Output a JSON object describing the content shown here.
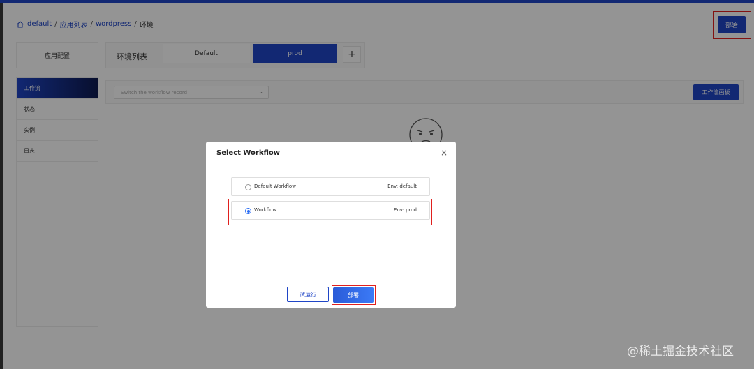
{
  "breadcrumb": {
    "items": [
      "default",
      "应用列表",
      "wordpress"
    ],
    "current": "环境",
    "separator": "/"
  },
  "header": {
    "deploy_label": "部署"
  },
  "app_config_label": "应用配置",
  "env": {
    "title": "环境列表",
    "tabs": [
      "Default",
      "prod"
    ],
    "active_tab": "prod",
    "add_label": "+"
  },
  "sidebar": {
    "items": [
      {
        "label": "工作流",
        "active": true
      },
      {
        "label": "状态",
        "active": false
      },
      {
        "label": "实例",
        "active": false
      },
      {
        "label": "日志",
        "active": false
      }
    ]
  },
  "workflow_bar": {
    "select_placeholder": "Switch the workflow record",
    "board_label": "工作流画板"
  },
  "modal": {
    "title": "Select Workflow",
    "close_label": "×",
    "options": [
      {
        "name": "Default Workflow",
        "env": "Env: default",
        "selected": false
      },
      {
        "name": "Workflow",
        "env": "Env: prod",
        "selected": true
      }
    ],
    "trial_label": "试运行",
    "deploy_label": "部署"
  },
  "watermark": "@稀土掘金技术社区",
  "colors": {
    "primary": "#1f45c6",
    "highlight": "#e0201e",
    "radio": "#2a6df4"
  }
}
